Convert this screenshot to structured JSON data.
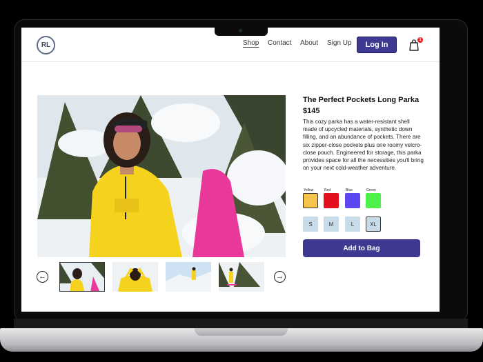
{
  "header": {
    "logo_text": "RL",
    "nav": [
      "Shop",
      "Contact",
      "About",
      "Sign Up"
    ],
    "active_nav": "Shop",
    "login_label": "Log In",
    "cart_count": "1"
  },
  "product": {
    "title": "The Perfect Pockets Long Parka",
    "price": "$145",
    "description": "This cozy parka has a water-resistant shell made of upcycled materials, synthetic down filling, and an abundance of pockets. There are six zipper-close pockets plus one roomy velcro-close pouch. Engineered for storage, this parka provides space for all the necessities you'll bring on your next cold-weather adventure.",
    "colors": [
      {
        "label": "Yellow",
        "hex": "#f6c44c",
        "selected": true
      },
      {
        "label": "Red",
        "hex": "#e1101c",
        "selected": false
      },
      {
        "label": "Blue",
        "hex": "#5b48f0",
        "selected": false
      },
      {
        "label": "Green",
        "hex": "#4ff04a",
        "selected": false
      }
    ],
    "sizes": [
      "S",
      "M",
      "L",
      "XL"
    ],
    "selected_size": "XL",
    "add_label": "Add to Bag"
  },
  "gallery": {
    "prev_icon": "arrow-left-icon",
    "next_icon": "arrow-right-icon",
    "thumbnail_count": 4,
    "selected_index": 0
  }
}
